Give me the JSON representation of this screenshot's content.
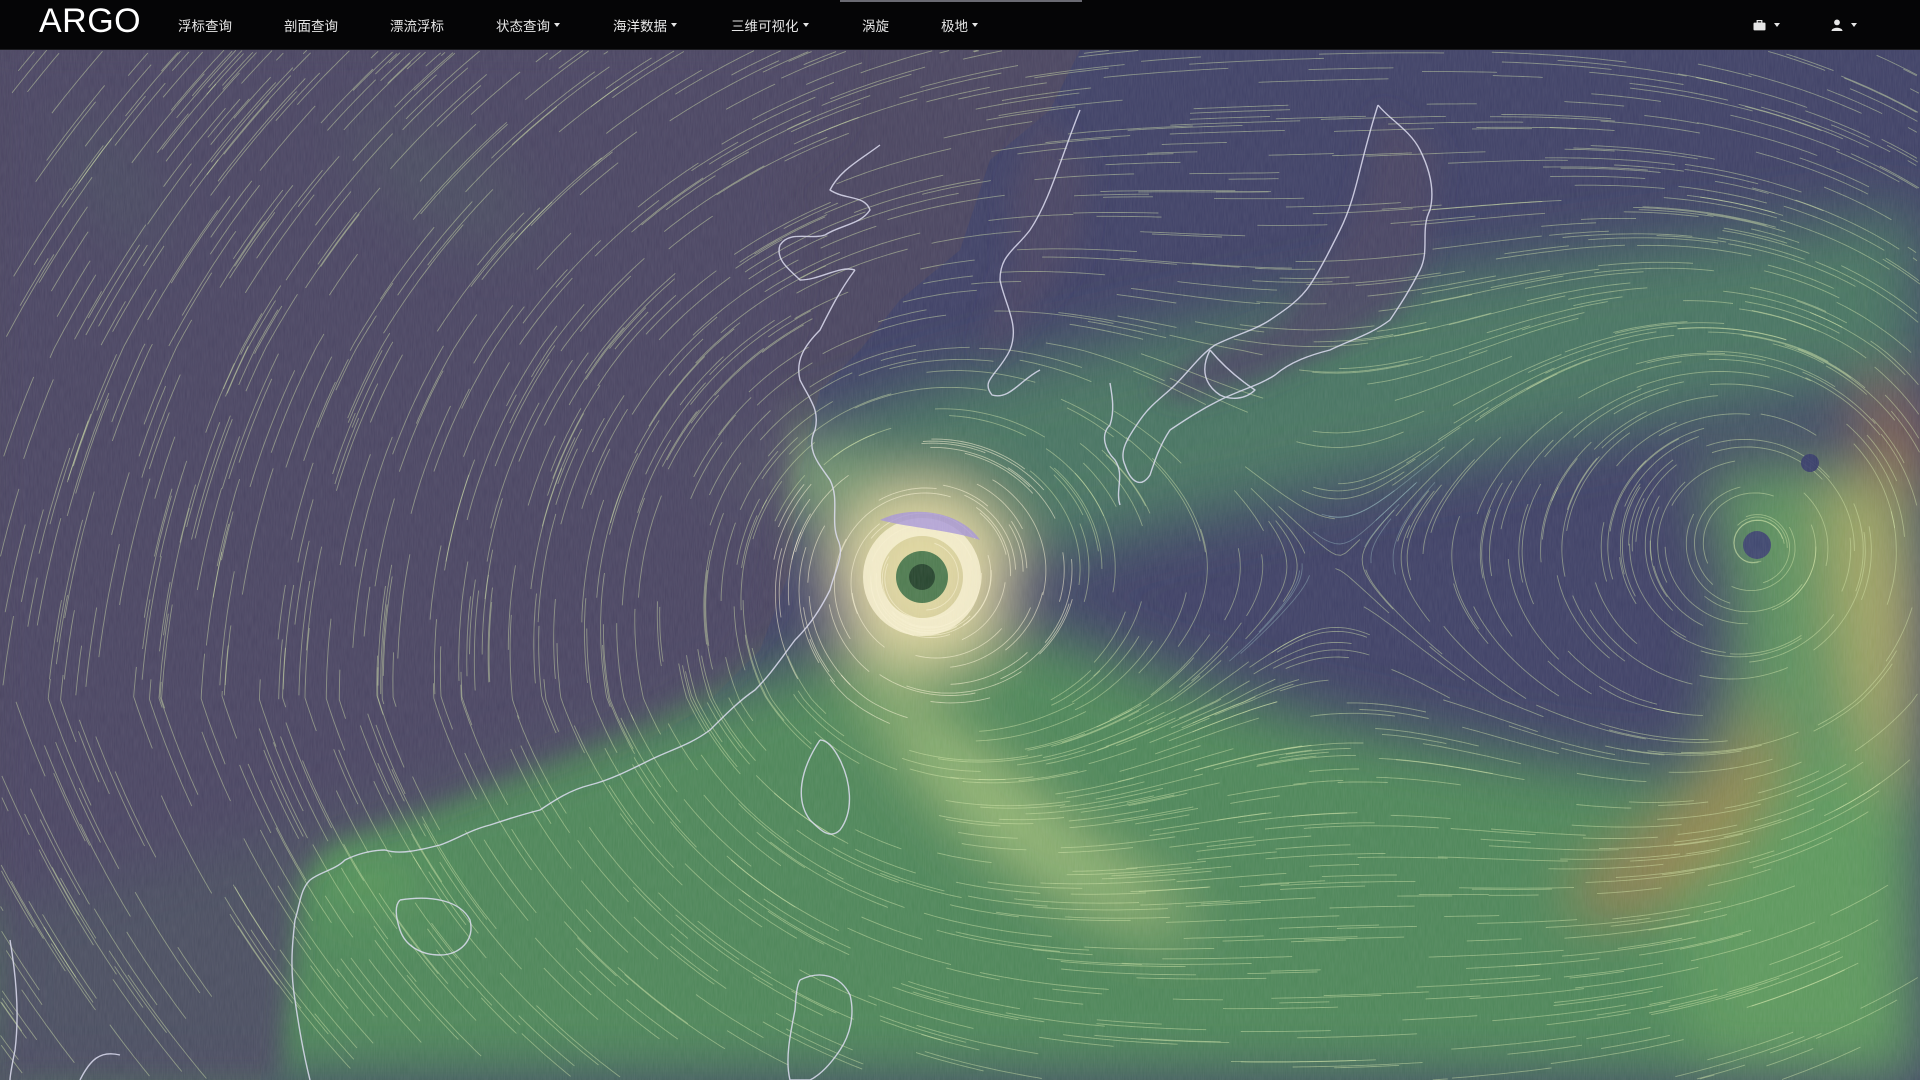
{
  "brand": "ARGO",
  "nav": {
    "items": [
      {
        "label": "浮标查询",
        "dropdown": false
      },
      {
        "label": "剖面查询",
        "dropdown": false
      },
      {
        "label": "漂流浮标",
        "dropdown": false
      },
      {
        "label": "状态查询",
        "dropdown": true
      },
      {
        "label": "海洋数据",
        "dropdown": true
      },
      {
        "label": "三维可视化",
        "dropdown": true
      },
      {
        "label": "涡旋",
        "dropdown": false
      },
      {
        "label": "极地",
        "dropdown": true
      }
    ],
    "right_icons": [
      {
        "icon": "briefcase-icon",
        "dropdown": true
      },
      {
        "icon": "user-icon",
        "dropdown": true
      }
    ]
  },
  "map": {
    "layer": "wind-streamlines",
    "colors": {
      "land": "#4a4360",
      "calm": "#3c4a74",
      "moderate": "#4f8a5a",
      "strong": "#a6c27a",
      "very_strong": "#e8dca4",
      "extreme": "#c87a4a",
      "coastline": "#dcdcf0"
    }
  }
}
